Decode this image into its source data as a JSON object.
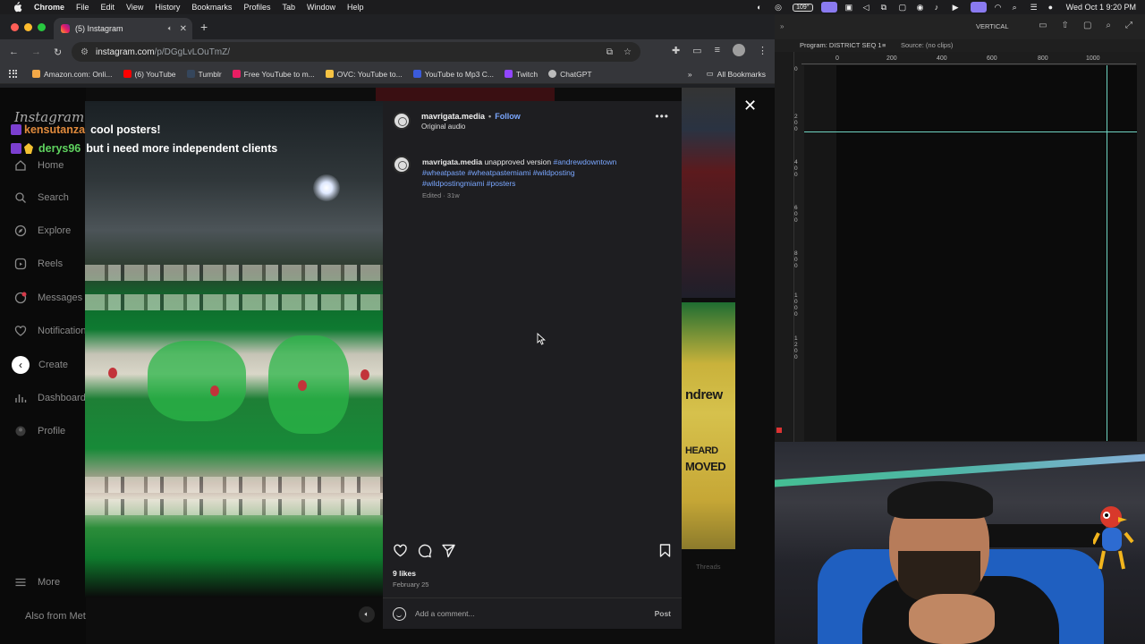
{
  "menubar": {
    "app": "Chrome",
    "items": [
      "File",
      "Edit",
      "View",
      "History",
      "Bookmarks",
      "Profiles",
      "Tab",
      "Window",
      "Help"
    ],
    "battery": "109°",
    "clock": "Wed Oct 1  9:20 PM"
  },
  "browser": {
    "tab_title": "(5) Instagram",
    "url_domain": "instagram.com",
    "url_path": "/p/DGgLvLOuTmZ/",
    "bookmarks": [
      {
        "label": "Amazon.com: Onli...",
        "color": "#f3a847"
      },
      {
        "label": "(6) YouTube",
        "color": "#ff0000"
      },
      {
        "label": "Tumblr",
        "color": "#35465c"
      },
      {
        "label": "Free YouTube to m...",
        "color": "#e91e63"
      },
      {
        "label": "OVC: YouTube to...",
        "color": "#f6c343"
      },
      {
        "label": "YouTube to Mp3 C...",
        "color": "#3b5bdb"
      },
      {
        "label": "Twitch",
        "color": "#9146ff"
      },
      {
        "label": "ChatGPT",
        "color": "#bbbbbb"
      }
    ],
    "all_bookmarks": "All Bookmarks"
  },
  "instagram": {
    "logo": "Instagram",
    "nav": [
      {
        "label": "Home",
        "icon": "home-icon"
      },
      {
        "label": "Search",
        "icon": "search-icon"
      },
      {
        "label": "Explore",
        "icon": "explore-icon"
      },
      {
        "label": "Reels",
        "icon": "reels-icon"
      },
      {
        "label": "Messages",
        "icon": "messages-icon"
      },
      {
        "label": "Notifications",
        "icon": "heart-icon"
      },
      {
        "label": "Create",
        "icon": "create-icon"
      },
      {
        "label": "Dashboard",
        "icon": "dashboard-icon"
      },
      {
        "label": "Profile",
        "icon": "profile-icon"
      }
    ],
    "more": "More",
    "also_from": "Also from Meta",
    "threads": "Threads"
  },
  "chat_overlay": [
    {
      "user": "kensutanza",
      "message": "cool posters!"
    },
    {
      "user": "derys96",
      "message": "but i need more independent clients"
    }
  ],
  "post": {
    "username": "mavrigata.media",
    "follow": "Follow",
    "audio": "Original audio",
    "caption_text": "unapproved version",
    "hashtags_line1": "#andrewdowntown",
    "hashtags_line2": "#wheatpaste #wheatpastemiami #wildposting",
    "hashtags_line3": "#wildpostingmiami #posters",
    "edited": "Edited · 31w",
    "likes": "9 likes",
    "date": "February 25",
    "comment_placeholder": "Add a comment...",
    "post_button": "Post"
  },
  "premiere": {
    "vertical": "VERTICAL",
    "program": "Program: DISTRICT SEQ 1",
    "source": "Source: (no clips)",
    "ruler_top": [
      "0",
      "200",
      "400",
      "600",
      "800",
      "1000"
    ]
  }
}
